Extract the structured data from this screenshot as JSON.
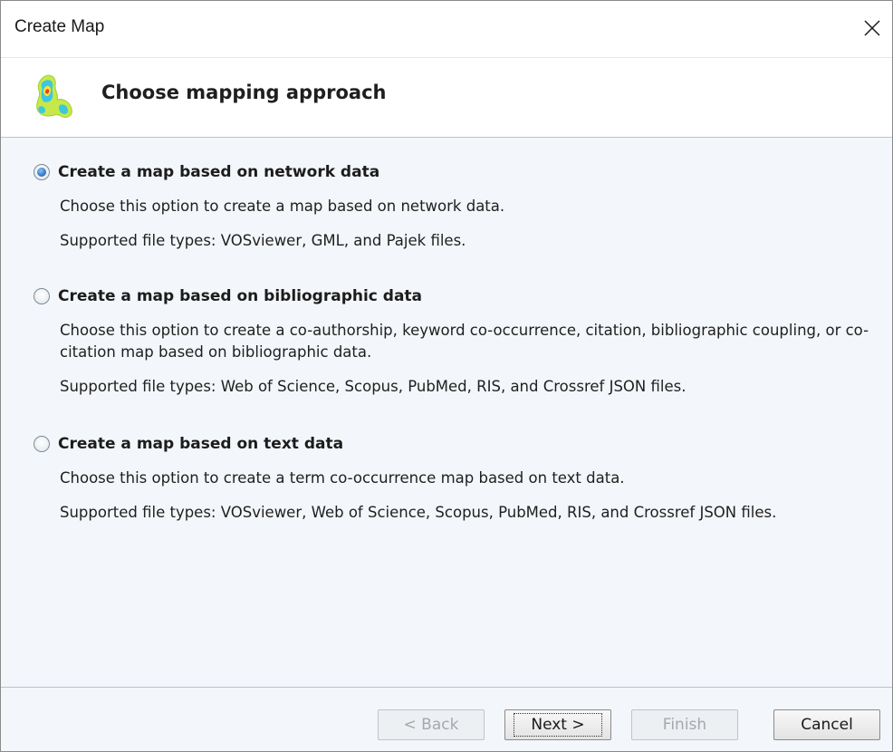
{
  "window": {
    "title": "Create Map",
    "close_icon": "close-icon"
  },
  "header": {
    "icon": "density-map-icon",
    "title": "Choose mapping approach"
  },
  "options": [
    {
      "label": "Create a map based on network data",
      "selected": true,
      "description": "Choose this option to create a map based on network data.",
      "file_types": "Supported file types: VOSviewer, GML, and Pajek files."
    },
    {
      "label": "Create a map based on bibliographic data",
      "selected": false,
      "description": "Choose this option to create a co-authorship, keyword co-occurrence, citation, bibliographic coupling, or co-citation map based on bibliographic data.",
      "file_types": "Supported file types: Web of Science, Scopus, PubMed, RIS, and Crossref JSON files."
    },
    {
      "label": "Create a map based on text data",
      "selected": false,
      "description": "Choose this option to create a term co-occurrence map based on text data.",
      "file_types": "Supported file types: VOSviewer, Web of Science, Scopus, PubMed, RIS, and Crossref JSON files."
    }
  ],
  "buttons": {
    "back": {
      "label": "< Back",
      "enabled": false
    },
    "next": {
      "label": "Next >",
      "enabled": true
    },
    "finish": {
      "label": "Finish",
      "enabled": false
    },
    "cancel": {
      "label": "Cancel",
      "enabled": true
    }
  },
  "colors": {
    "background": "#f3f6fa",
    "radio_selected": "#3a7fc8"
  }
}
